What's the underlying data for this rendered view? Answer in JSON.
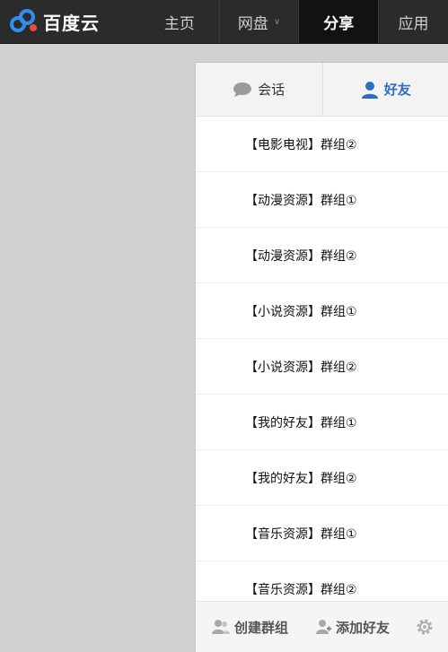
{
  "topnav": {
    "logo_text": "百度云",
    "items": [
      {
        "label": "主页"
      },
      {
        "label": "网盘"
      },
      {
        "label": "分享"
      },
      {
        "label": "应用"
      }
    ]
  },
  "panel": {
    "tabs": [
      {
        "label": "会话",
        "icon": "chat-bubble-icon"
      },
      {
        "label": "好友",
        "icon": "user-icon",
        "active": true
      }
    ],
    "groups": [
      {
        "name": "【电影电视】群组②"
      },
      {
        "name": "【动漫资源】群组①"
      },
      {
        "name": "【动漫资源】群组②"
      },
      {
        "name": "【小说资源】群组①"
      },
      {
        "name": "【小说资源】群组②"
      },
      {
        "name": "【我的好友】群组①"
      },
      {
        "name": "【我的好友】群组②"
      },
      {
        "name": "【音乐资源】群组①"
      },
      {
        "name": "【音乐资源】群组②"
      }
    ],
    "footer": {
      "create_group": "创建群组",
      "add_friend": "添加好友"
    }
  },
  "colors": {
    "accent": "#2c6fbe",
    "topbar": "#2b2b2b",
    "active_nav": "#121212",
    "background": "#d1d1d1"
  }
}
